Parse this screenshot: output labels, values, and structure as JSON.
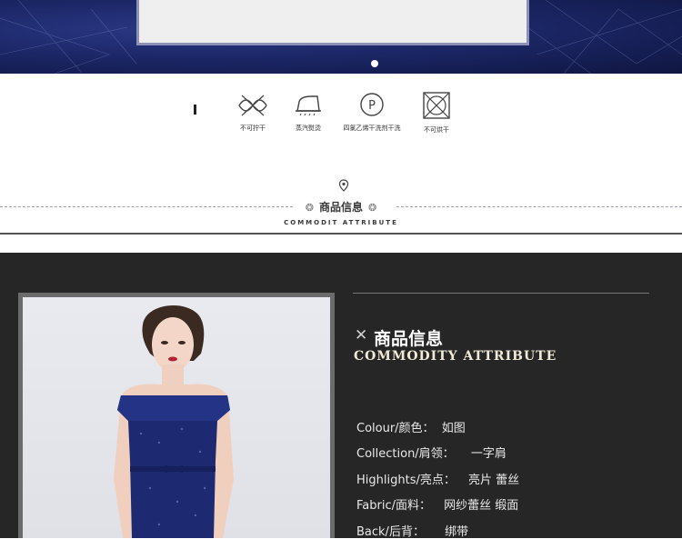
{
  "care": {
    "items": [
      {
        "icon": "no-wring-icon",
        "label": "不可拧干"
      },
      {
        "icon": "steam-iron-icon",
        "label": "蒸汽熨烫"
      },
      {
        "icon": "dry-clean-p-icon",
        "label": "四氯乙烯干洗剂干洗"
      },
      {
        "icon": "no-tumble-dry-icon",
        "label": "不可烘干"
      }
    ]
  },
  "section": {
    "title": "商品信息",
    "subtitle": "COMMODIT ATTRIBUTE"
  },
  "attributes": {
    "title": "商品信息",
    "subtitle": "COMMODITY ATTRIBUTE",
    "rows": [
      {
        "key": "Colour/颜色：",
        "value": "如图"
      },
      {
        "key": "Collection/肩领：",
        "value": "一字肩"
      },
      {
        "key": "Highlights/亮点：",
        "value": "亮片 蕾丝"
      },
      {
        "key": "Fabric/面料：",
        "value": "网纱蕾丝  缎面"
      },
      {
        "key": "Back/后背：",
        "value": "绑带"
      }
    ]
  },
  "colors": {
    "banner": "#1c2767",
    "dark_bg": "#262626",
    "dress": "#1d2a72"
  }
}
